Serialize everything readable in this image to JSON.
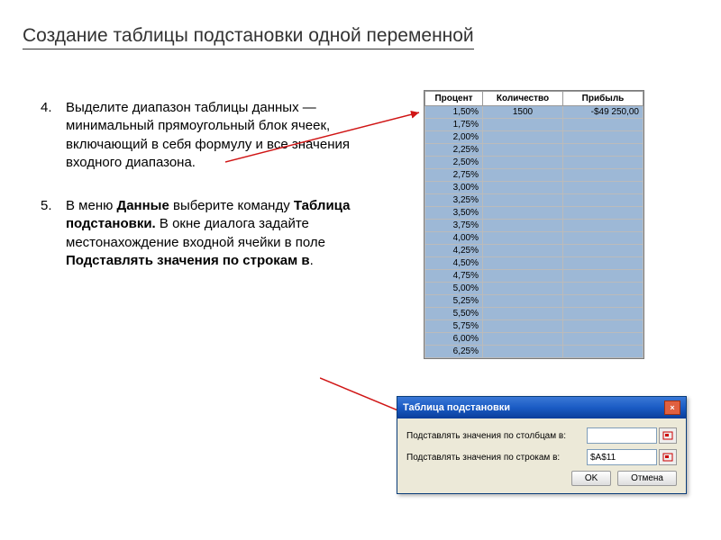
{
  "title": "Создание таблицы подстановки одной переменной",
  "items": [
    {
      "num": "4.",
      "text": "Выделите диапазон таблицы данных — минимальный прямоугольный блок ячеек, включающий в себя формулу и все значения входного диапазона."
    },
    {
      "num": "5.",
      "t1": "В меню ",
      "b1": "Данные",
      "t2": " выберите команду ",
      "b2": "Таблица подстановки.",
      "t3": " В окне диалога задайте местонахождение входной ячейки в поле ",
      "b3": "Подставлять значения по строкам в",
      "t4": "."
    }
  ],
  "excel": {
    "headers": [
      "Процент",
      "Количество",
      "Прибыль"
    ],
    "first_row": {
      "pct": "1,50%",
      "qty": "1500",
      "profit": "-$49 250,00"
    },
    "pcts": [
      "1,75%",
      "2,00%",
      "2,25%",
      "2,50%",
      "2,75%",
      "3,00%",
      "3,25%",
      "3,50%",
      "3,75%",
      "4,00%",
      "4,25%",
      "4,50%",
      "4,75%",
      "5,00%",
      "5,25%",
      "5,50%",
      "5,75%",
      "6,00%",
      "6,25%"
    ]
  },
  "dialog": {
    "title": "Таблица подстановки",
    "close": "×",
    "row1_label": "Подставлять значения по столбцам в:",
    "row1_value": "",
    "row2_label": "Подставлять значения по строкам в:",
    "row2_value": "$A$11",
    "ok": "OK",
    "cancel": "Отмена"
  }
}
